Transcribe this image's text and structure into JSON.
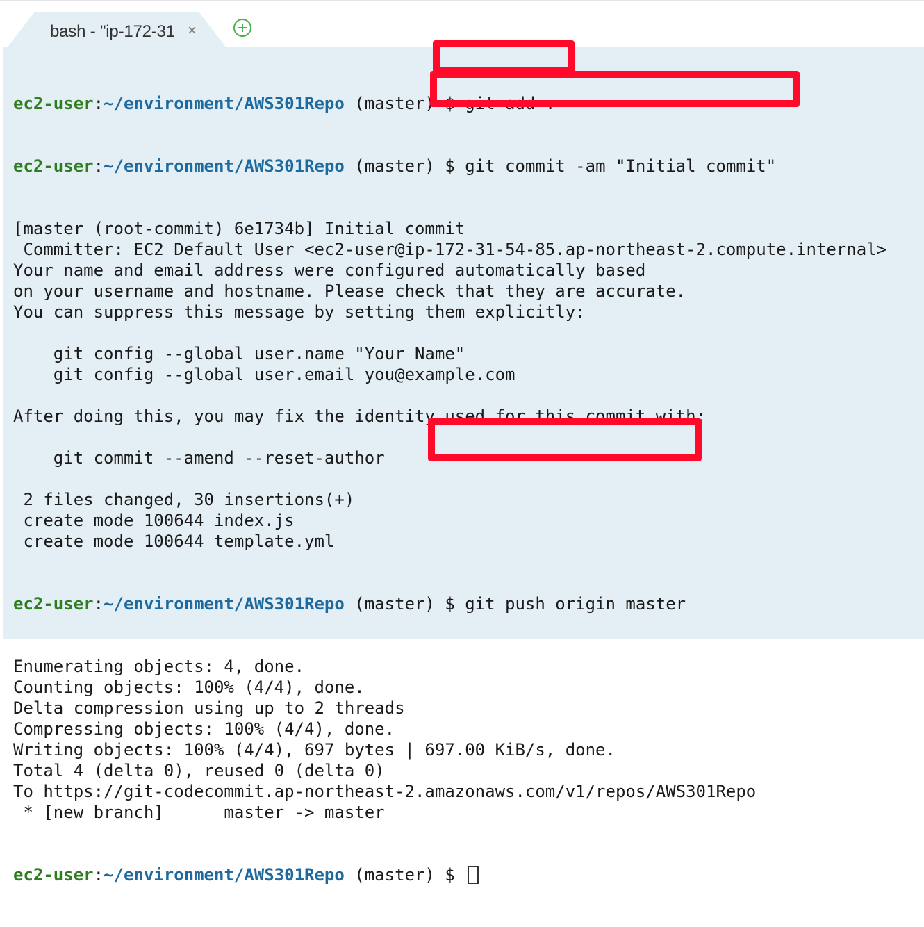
{
  "tab": {
    "title": "bash - \"ip-172-31",
    "close_glyph": "×"
  },
  "prompt": {
    "user": "ec2-user",
    "separator": ":",
    "path": "~/environment/AWS301Repo",
    "branch": " (master) "
  },
  "commands": {
    "add": "$ git add .",
    "commit": "$ git commit -am \"Initial commit\"",
    "push": "$ git push origin master",
    "final": "$ "
  },
  "output": {
    "commit_lines": [
      "[master (root-commit) 6e1734b] Initial commit",
      " Committer: EC2 Default User <ec2-user@ip-172-31-54-85.ap-northeast-2.compute.internal>",
      "Your name and email address were configured automatically based",
      "on your username and hostname. Please check that they are accurate.",
      "You can suppress this message by setting them explicitly:",
      "",
      "    git config --global user.name \"Your Name\"",
      "    git config --global user.email you@example.com",
      "",
      "After doing this, you may fix the identity used for this commit with:",
      "",
      "    git commit --amend --reset-author",
      "",
      " 2 files changed, 30 insertions(+)",
      " create mode 100644 index.js",
      " create mode 100644 template.yml"
    ],
    "push_lines": [
      "Enumerating objects: 4, done.",
      "Counting objects: 100% (4/4), done.",
      "Delta compression using up to 2 threads",
      "Compressing objects: 100% (4/4), done.",
      "Writing objects: 100% (4/4), 697 bytes | 697.00 KiB/s, done.",
      "Total 4 (delta 0), reused 0 (delta 0)",
      "To https://git-codecommit.ap-northeast-2.amazonaws.com/v1/repos/AWS301Repo",
      " * [new branch]      master -> master"
    ]
  },
  "colors": {
    "terminal_bg": "#e4eef5",
    "user": "#2e7d1f",
    "path": "#1e6a9e",
    "highlight": "#ff0a2a"
  }
}
